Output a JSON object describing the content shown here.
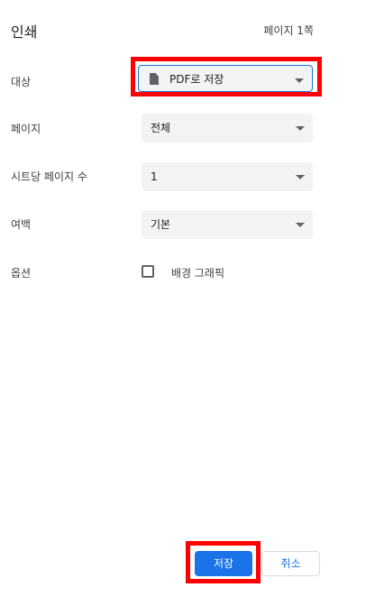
{
  "header": {
    "title": "인쇄",
    "page_count": "페이지 1쪽"
  },
  "settings": {
    "destination": {
      "label": "대상",
      "value": "PDF로 저장"
    },
    "pages": {
      "label": "페이지",
      "value": "전체"
    },
    "pages_per_sheet": {
      "label": "시트당 페이지 수",
      "value": "1"
    },
    "margins": {
      "label": "여백",
      "value": "기본"
    },
    "options": {
      "label": "옵션",
      "background_graphics_label": "배경 그래픽",
      "background_graphics_checked": false
    }
  },
  "footer": {
    "save_label": "저장",
    "cancel_label": "취소"
  },
  "colors": {
    "accent": "#1a73e8",
    "highlight": "#ff0000"
  }
}
